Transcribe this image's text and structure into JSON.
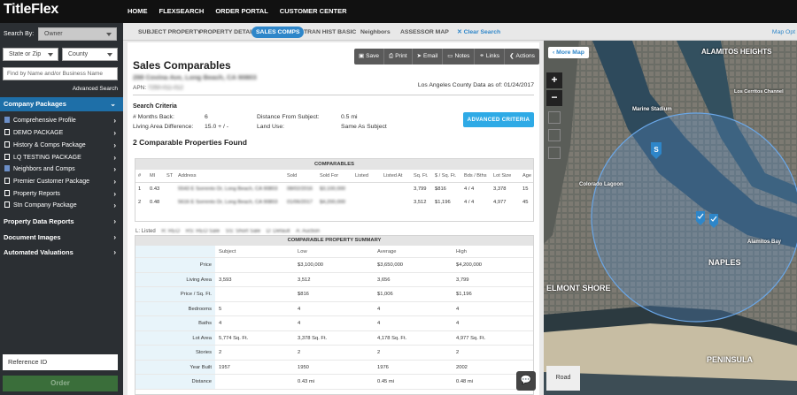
{
  "app": {
    "logo": "TitleFlex"
  },
  "topnav": [
    "HOME",
    "FLEXSEARCH",
    "ORDER PORTAL",
    "CUSTOMER CENTER"
  ],
  "sidebar": {
    "search_by_label": "Search By:",
    "search_by_value": "Owner",
    "state_placeholder": "State or Zip",
    "county_placeholder": "County",
    "name_placeholder": "Find by Name and/or Business Name",
    "advanced_search": "Advanced Search",
    "company_packages": "Company Packages",
    "packages": [
      {
        "label": "Comprehensive Profile",
        "icon": "document-icon"
      },
      {
        "label": "DEMO PACKAGE",
        "icon": "box-icon"
      },
      {
        "label": "History & Comps Package",
        "icon": "box-icon"
      },
      {
        "label": "LQ TESTING PACKAGE",
        "icon": "box-icon"
      },
      {
        "label": "Neighbors and Comps",
        "icon": "document-icon"
      },
      {
        "label": "Premier Customer Package",
        "icon": "box-icon"
      },
      {
        "label": "Property Reports",
        "icon": "box-icon"
      },
      {
        "label": "Stn Company Package",
        "icon": "box-icon"
      }
    ],
    "sections": [
      "Property Data Reports",
      "Document Images",
      "Automated Valuations"
    ],
    "reference_placeholder": "Reference ID",
    "order_button": "Order"
  },
  "subnav": {
    "tabs": [
      "SUBJECT PROPERTY",
      "PROPERTY DETAIL",
      "SALES COMPS",
      "TRAN HIST BASIC",
      "Neighbors",
      "ASSESSOR MAP"
    ],
    "active_tab": "SALES COMPS",
    "clear_search": "Clear Search",
    "map_options": "Map Opt"
  },
  "report": {
    "title": "Sales Comparables",
    "address": "298 Covina Ave, Long Beach, CA 90803",
    "apn_label": "APN:",
    "apn_value": "7250-011-012",
    "county_date": "Los Angeles County Data as of: 01/24/2017",
    "toolbar": [
      {
        "label": "Save",
        "icon": "save-icon",
        "glyph": "▣"
      },
      {
        "label": "Print",
        "icon": "print-icon",
        "glyph": "⎙"
      },
      {
        "label": "Email",
        "icon": "send-icon",
        "glyph": "➤"
      },
      {
        "label": "Notes",
        "icon": "notes-icon",
        "glyph": "▭"
      },
      {
        "label": "Links",
        "icon": "link-icon",
        "glyph": "⚭"
      },
      {
        "label": "Actions",
        "icon": "chevron-left-icon",
        "glyph": "❮"
      }
    ]
  },
  "criteria": {
    "title": "Search Criteria",
    "months_back_label": "# Months Back:",
    "months_back_value": "6",
    "living_area_label": "Living Area Difference:",
    "living_area_value": "15.0 + / -",
    "distance_label": "Distance From Subject:",
    "distance_value": "0.5 mi",
    "land_use_label": "Land Use:",
    "land_use_value": "Same As Subject",
    "advanced_button": "ADVANCED CRITERIA"
  },
  "found_heading": "2 Comparable Properties Found",
  "comparables": {
    "title": "COMPARABLES",
    "headers": [
      "#",
      "MI",
      "ST",
      "Address",
      "Sold",
      "Sold For",
      "Listed",
      "Listed At",
      "Sq. Ft.",
      "$ / Sq. Ft.",
      "Bds / Bths",
      "Lot Size",
      "Age"
    ],
    "rows": [
      [
        "1",
        "0.43",
        "",
        "5543 E Sorrento Dr, Long Beach, CA 90803",
        "08/02/2016",
        "$3,100,000",
        "",
        "",
        "3,799",
        "$816",
        "4 / 4",
        "3,378",
        "15"
      ],
      [
        "2",
        "0.48",
        "",
        "5616 E Sorrento Dr, Long Beach, CA 90803",
        "01/06/2017",
        "$4,200,000",
        "",
        "",
        "3,512",
        "$1,196",
        "4 / 4",
        "4,977",
        "45"
      ]
    ]
  },
  "legend": {
    "prefix": "L: Listed",
    "items": [
      "R: REO",
      "RS: REO Sale",
      "SS: Short Sale",
      "D: Default",
      "A: Auction"
    ]
  },
  "summary": {
    "title": "COMPARABLE PROPERTY SUMMARY",
    "columns": [
      "Subject",
      "Low",
      "Average",
      "High"
    ],
    "rows": [
      {
        "label": "Price",
        "values": [
          "",
          "$3,100,000",
          "$3,650,000",
          "$4,200,000"
        ]
      },
      {
        "label": "Living Area",
        "values": [
          "3,593",
          "3,512",
          "3,656",
          "3,799"
        ]
      },
      {
        "label": "Price / Sq. Ft.",
        "values": [
          "",
          "$816",
          "$1,006",
          "$1,196"
        ]
      },
      {
        "label": "Bedrooms",
        "values": [
          "5",
          "4",
          "4",
          "4"
        ]
      },
      {
        "label": "Baths",
        "values": [
          "4",
          "4",
          "4",
          "4"
        ]
      },
      {
        "label": "Lot Area",
        "values": [
          "5,774 Sq. Ft.",
          "3,378 Sq. Ft.",
          "4,178 Sq. Ft.",
          "4,977 Sq. Ft."
        ]
      },
      {
        "label": "Stories",
        "values": [
          "2",
          "2",
          "2",
          "2"
        ]
      },
      {
        "label": "Year Built",
        "values": [
          "1957",
          "1950",
          "1976",
          "2002"
        ]
      },
      {
        "label": "Distance",
        "values": [
          "",
          "0.43 mi",
          "0.45 mi",
          "0.48 mi"
        ]
      }
    ]
  },
  "map": {
    "more_map": "More Map",
    "zoom_in": "+",
    "zoom_out": "−",
    "road_button": "Road",
    "labels": [
      "ALAMITOS HEIGHTS",
      "ELMONT SHORE",
      "NAPLES",
      "PENINSULA",
      "Marine Stadium",
      "Alamitos Bay",
      "Colorado Lagoon",
      "Los Cerritos Channel"
    ],
    "subject_marker": "S"
  },
  "colors": {
    "accent": "#2e86c9",
    "sidebar": "#2b2f33",
    "topbar": "#111111",
    "order": "#3a6e3a"
  }
}
